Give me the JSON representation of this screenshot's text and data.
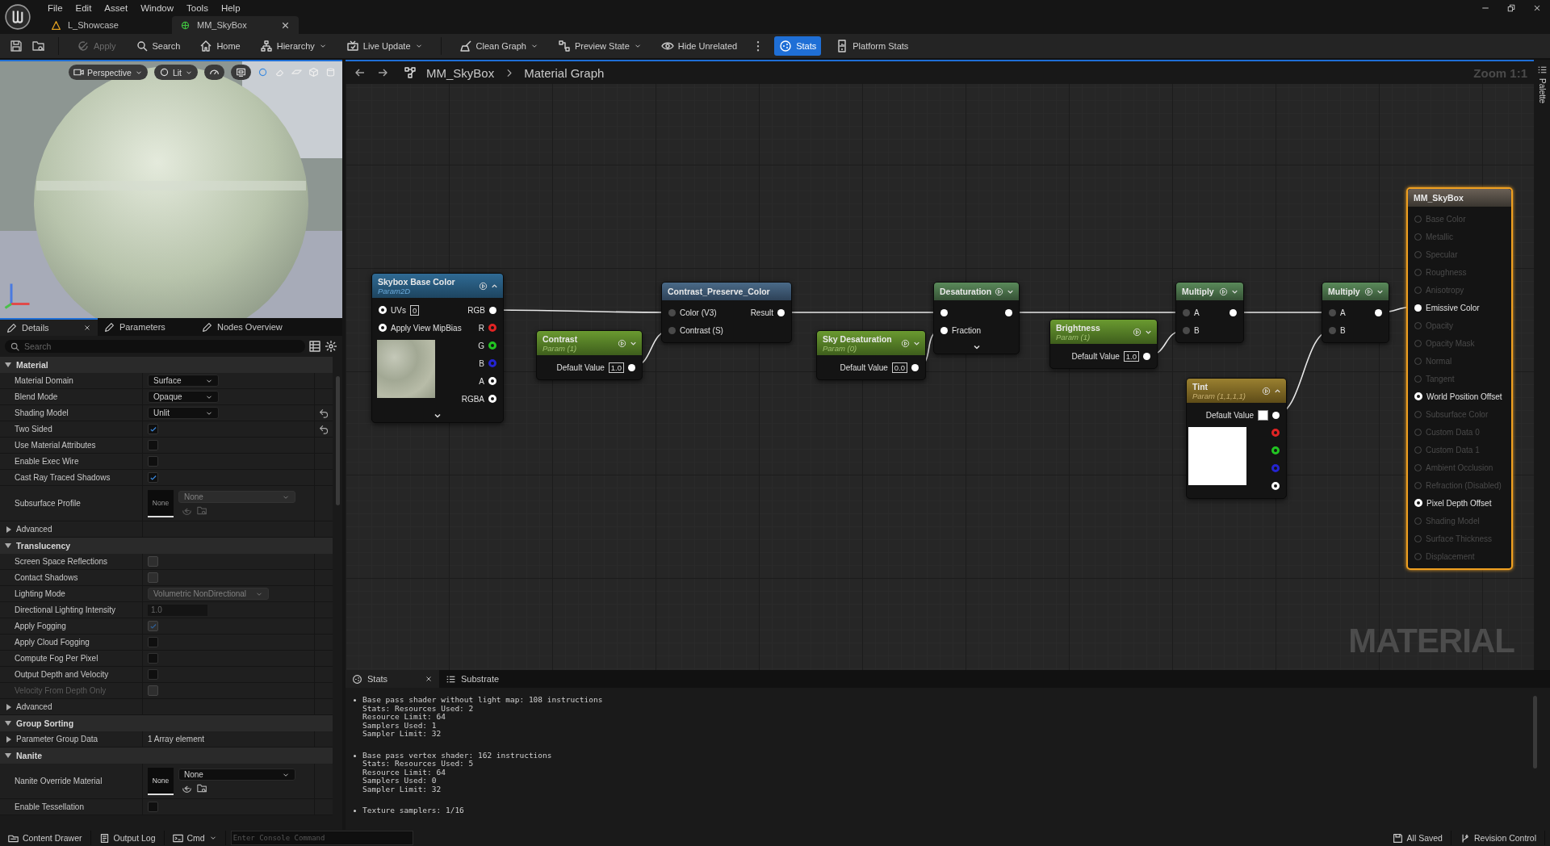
{
  "menu": [
    "File",
    "Edit",
    "Asset",
    "Window",
    "Tools",
    "Help"
  ],
  "tabs": [
    {
      "label": "L_Showcase",
      "kind": "level",
      "selected": false
    },
    {
      "label": "MM_SkyBox",
      "kind": "material",
      "selected": true
    }
  ],
  "toolbar": [
    {
      "label": "Apply",
      "kind": "apply",
      "disabled": true,
      "selected": false,
      "dropdown": false
    },
    {
      "label": "Search",
      "kind": "search",
      "disabled": false,
      "selected": false,
      "dropdown": false
    },
    {
      "label": "Home",
      "kind": "home",
      "disabled": false,
      "selected": false,
      "dropdown": false
    },
    {
      "label": "Hierarchy",
      "kind": "hierarchy",
      "disabled": false,
      "selected": false,
      "dropdown": true
    },
    {
      "label": "Live Update",
      "kind": "live",
      "disabled": false,
      "selected": false,
      "dropdown": true
    },
    {
      "label": "Clean Graph",
      "kind": "clean",
      "disabled": false,
      "selected": false,
      "dropdown": true
    },
    {
      "label": "Preview State",
      "kind": "preview",
      "disabled": false,
      "selected": false,
      "dropdown": true
    },
    {
      "label": "Hide Unrelated",
      "kind": "hide",
      "disabled": false,
      "selected": false,
      "dropdown": false
    },
    {
      "label": "Stats",
      "kind": "stats",
      "disabled": false,
      "selected": true,
      "dropdown": false
    },
    {
      "label": "Platform Stats",
      "kind": "platform",
      "disabled": false,
      "selected": false,
      "dropdown": false
    }
  ],
  "viewport": {
    "buttons": [
      {
        "label": "Perspective",
        "kind": "camera"
      },
      {
        "label": "Lit",
        "kind": "lit"
      }
    ]
  },
  "details": {
    "tabs": [
      {
        "label": "Details",
        "selected": true
      },
      {
        "label": "Parameters",
        "selected": false
      },
      {
        "label": "Nodes Overview",
        "selected": false
      }
    ],
    "search": {
      "placeholder": "Search"
    },
    "sections": [
      {
        "title": "Material",
        "expanded": true,
        "rows": [
          {
            "kind": "dropdown",
            "label": "Material Domain",
            "value": "Surface",
            "disabled": false,
            "inactive": false,
            "resettable": false
          },
          {
            "kind": "dropdown",
            "label": "Blend Mode",
            "value": "Opaque",
            "disabled": false,
            "inactive": false,
            "resettable": false
          },
          {
            "kind": "dropdown",
            "label": "Shading Model",
            "value": "Unlit",
            "disabled": false,
            "inactive": false,
            "resettable": true
          },
          {
            "kind": "checkbox",
            "label": "Two Sided",
            "checked": true,
            "disabled": false,
            "inactive": false,
            "resettable": true
          },
          {
            "kind": "checkbox",
            "label": "Use Material Attributes",
            "checked": false,
            "disabled": false,
            "inactive": false,
            "resettable": false
          },
          {
            "kind": "checkbox",
            "label": "Enable Exec Wire",
            "checked": false,
            "disabled": false,
            "inactive": false,
            "resettable": false
          },
          {
            "kind": "checkbox",
            "label": "Cast Ray Traced Shadows",
            "checked": true,
            "disabled": false,
            "inactive": false,
            "resettable": false
          },
          {
            "kind": "asset",
            "label": "Subsurface Profile",
            "thumb": "None",
            "value": "None",
            "disabled": true,
            "inactive": false,
            "resettable": false
          },
          {
            "kind": "group",
            "label": "Advanced",
            "expanded": false,
            "inactive": false,
            "resettable": false
          }
        ]
      },
      {
        "title": "Translucency",
        "expanded": true,
        "rows": [
          {
            "kind": "checkbox",
            "label": "Screen Space Reflections",
            "checked": false,
            "disabled": true,
            "inactive": false,
            "resettable": false
          },
          {
            "kind": "checkbox",
            "label": "Contact Shadows",
            "checked": false,
            "disabled": true,
            "inactive": false,
            "resettable": false
          },
          {
            "kind": "dropdown",
            "label": "Lighting Mode",
            "value": "Volumetric NonDirectional",
            "disabled": true,
            "inactive": false,
            "resettable": false
          },
          {
            "kind": "number",
            "label": "Directional Lighting Intensity",
            "value": "1.0",
            "disabled": true,
            "inactive": false,
            "resettable": false
          },
          {
            "kind": "checkbox",
            "label": "Apply Fogging",
            "checked": true,
            "disabled": true,
            "inactive": false,
            "resettable": false
          },
          {
            "kind": "checkbox",
            "label": "Apply Cloud Fogging",
            "checked": false,
            "disabled": false,
            "inactive": false,
            "resettable": false
          },
          {
            "kind": "checkbox",
            "label": "Compute Fog Per Pixel",
            "checked": false,
            "disabled": false,
            "inactive": false,
            "resettable": false
          },
          {
            "kind": "checkbox",
            "label": "Output Depth and Velocity",
            "checked": false,
            "disabled": false,
            "inactive": false,
            "resettable": false
          },
          {
            "kind": "checkbox",
            "label": "Velocity From Depth Only",
            "checked": false,
            "disabled": true,
            "inactive": true,
            "resettable": false
          },
          {
            "kind": "group",
            "label": "Advanced",
            "expanded": false,
            "inactive": false,
            "resettable": false
          }
        ]
      },
      {
        "title": "Group Sorting",
        "expanded": true,
        "rows": [
          {
            "kind": "group",
            "label": "Parameter Group Data",
            "value": "1 Array element",
            "expanded": false,
            "inactive": false,
            "resettable": false
          }
        ]
      },
      {
        "title": "Nanite",
        "expanded": true,
        "rows": [
          {
            "kind": "asset",
            "label": "Nanite Override Material",
            "thumb": "None",
            "value": "None",
            "disabled": false,
            "inactive": false,
            "resettable": false
          },
          {
            "kind": "checkbox",
            "label": "Enable Tessellation",
            "checked": false,
            "disabled": false,
            "inactive": false,
            "resettable": false
          }
        ]
      }
    ]
  },
  "graph": {
    "breadcrumb": [
      "MM_SkyBox",
      "Material Graph"
    ],
    "zoom": "Zoom 1:1",
    "watermark": "MATERIAL",
    "palette": "Palette",
    "nodes": [
      {
        "kind": "texture",
        "title": "Skybox Base Color",
        "subtitle": "Param2D",
        "expanded": true,
        "advanced": true,
        "selected": false,
        "inputs": [
          {
            "label": "UVs",
            "value": "0",
            "connected": false,
            "active": true
          },
          {
            "label": "Apply View MipBias",
            "connected": false,
            "active": true
          }
        ],
        "outputs": [
          {
            "label": "RGB",
            "connected": true,
            "active": true,
            "color": "#ffffff"
          },
          {
            "label": "R",
            "connected": false,
            "active": true,
            "color": "#e02424"
          },
          {
            "label": "G",
            "connected": false,
            "active": true,
            "color": "#22c422"
          },
          {
            "label": "B",
            "connected": false,
            "active": true,
            "color": "#2424d0"
          },
          {
            "label": "A",
            "connected": false,
            "active": true,
            "color": "#ffffff"
          },
          {
            "label": "RGBA",
            "connected": false,
            "active": true,
            "color": "#ffffff"
          }
        ]
      },
      {
        "kind": "function",
        "title": "Contrast_Preserve_Color",
        "selected": false,
        "inputs": [
          {
            "label": "Color (V3)",
            "connected": true,
            "active": false
          },
          {
            "label": "Contrast (S)",
            "connected": true,
            "active": false
          }
        ],
        "outputs": [
          {
            "label": "Result",
            "connected": true,
            "active": true
          }
        ]
      },
      {
        "kind": "scalar",
        "title": "Contrast",
        "subtitle": "Param (1)",
        "expanded": false,
        "selected": false,
        "outputs": [
          {
            "label": "Default Value",
            "value": "1.0",
            "connected": true,
            "active": true
          }
        ]
      },
      {
        "kind": "scalar",
        "title": "Sky Desaturation",
        "subtitle": "Param (0)",
        "expanded": false,
        "selected": false,
        "outputs": [
          {
            "label": "Default Value",
            "value": "0.0",
            "connected": true,
            "active": true
          }
        ]
      },
      {
        "kind": "math",
        "title": "Desaturation",
        "expanded": false,
        "advanced": true,
        "selected": false,
        "inputs": [
          {
            "connected": true,
            "active": true
          },
          {
            "label": "Fraction",
            "connected": true,
            "active": true
          }
        ],
        "outputs": [
          {
            "connected": true,
            "active": true
          }
        ]
      },
      {
        "kind": "scalar",
        "title": "Brightness",
        "subtitle": "Param (1)",
        "expanded": false,
        "selected": false,
        "outputs": [
          {
            "label": "Default Value",
            "value": "1.0",
            "connected": true,
            "active": true
          }
        ]
      },
      {
        "kind": "math",
        "title": "Multiply",
        "expanded": false,
        "selected": false,
        "inputs": [
          {
            "label": "A",
            "connected": true,
            "active": false
          },
          {
            "label": "B",
            "connected": true,
            "active": false
          }
        ],
        "outputs": [
          {
            "connected": true,
            "active": true
          }
        ]
      },
      {
        "kind": "math",
        "title": "Multiply",
        "expanded": false,
        "selected": false,
        "inputs": [
          {
            "label": "A",
            "connected": true,
            "active": false
          },
          {
            "label": "B",
            "connected": true,
            "active": false
          }
        ],
        "outputs": [
          {
            "connected": true,
            "active": true
          }
        ]
      },
      {
        "kind": "vector",
        "title": "Tint",
        "subtitle": "Param (1,1,1,1)",
        "expanded": true,
        "selected": false,
        "color": "#ffffff",
        "outputs": [
          {
            "label": "Default Value",
            "connected": true,
            "active": true,
            "color": "#ffffff"
          },
          {
            "connected": false,
            "active": true,
            "color": "#e02424"
          },
          {
            "connected": false,
            "active": true,
            "color": "#22c422"
          },
          {
            "connected": false,
            "active": true,
            "color": "#2424d0"
          },
          {
            "connected": false,
            "active": true,
            "color": "#ffffff"
          }
        ]
      },
      {
        "kind": "result",
        "title": "MM_SkyBox",
        "selected": true,
        "inputs": [
          {
            "label": "Base Color",
            "connected": false,
            "active": false
          },
          {
            "label": "Metallic",
            "connected": false,
            "active": false
          },
          {
            "label": "Specular",
            "connected": false,
            "active": false
          },
          {
            "label": "Roughness",
            "connected": false,
            "active": false
          },
          {
            "label": "Anisotropy",
            "connected": false,
            "active": false
          },
          {
            "label": "Emissive Color",
            "connected": true,
            "active": true
          },
          {
            "label": "Opacity",
            "connected": false,
            "active": false
          },
          {
            "label": "Opacity Mask",
            "connected": false,
            "active": false
          },
          {
            "label": "Normal",
            "connected": false,
            "active": false
          },
          {
            "label": "Tangent",
            "connected": false,
            "active": false
          },
          {
            "label": "World Position Offset",
            "connected": false,
            "active": true
          },
          {
            "label": "Subsurface Color",
            "connected": false,
            "active": false
          },
          {
            "label": "Custom Data 0",
            "connected": false,
            "active": false
          },
          {
            "label": "Custom Data 1",
            "connected": false,
            "active": false
          },
          {
            "label": "Ambient Occlusion",
            "connected": false,
            "active": false
          },
          {
            "label": "Refraction (Disabled)",
            "connected": false,
            "active": false
          },
          {
            "label": "Pixel Depth Offset",
            "connected": false,
            "active": true
          },
          {
            "label": "Shading Model",
            "connected": false,
            "active": false
          },
          {
            "label": "Surface Thickness",
            "connected": false,
            "active": false
          },
          {
            "label": "Displacement",
            "connected": false,
            "active": false
          }
        ]
      }
    ]
  },
  "stats": {
    "tabs": [
      {
        "label": "Stats",
        "kind": "stats",
        "selected": true
      },
      {
        "label": "Substrate",
        "kind": "list",
        "selected": false
      }
    ],
    "entries": [
      {
        "lines": [
          "Base pass shader without light map: 108 instructions",
          "Stats: Resources Used: 2",
          "Resource Limit: 64",
          "Samplers Used: 1",
          "Sampler Limit: 32"
        ]
      },
      {
        "lines": [
          "Base pass vertex shader: 162 instructions",
          "Stats: Resources Used: 5",
          "Resource Limit: 64",
          "Samplers Used: 0",
          "Sampler Limit: 32"
        ]
      },
      {
        "lines": [
          "Texture samplers: 1/16"
        ]
      }
    ]
  },
  "status_bar": {
    "left": [
      {
        "label": "Content Drawer",
        "kind": "drawer"
      },
      {
        "label": "Output Log",
        "kind": "log"
      },
      {
        "label": "Cmd",
        "kind": "cmd"
      }
    ],
    "console": {
      "placeholder": "Enter Console Command"
    },
    "right": [
      {
        "label": "All Saved",
        "kind": "saved"
      },
      {
        "label": "Revision Control",
        "kind": "revision"
      }
    ]
  }
}
